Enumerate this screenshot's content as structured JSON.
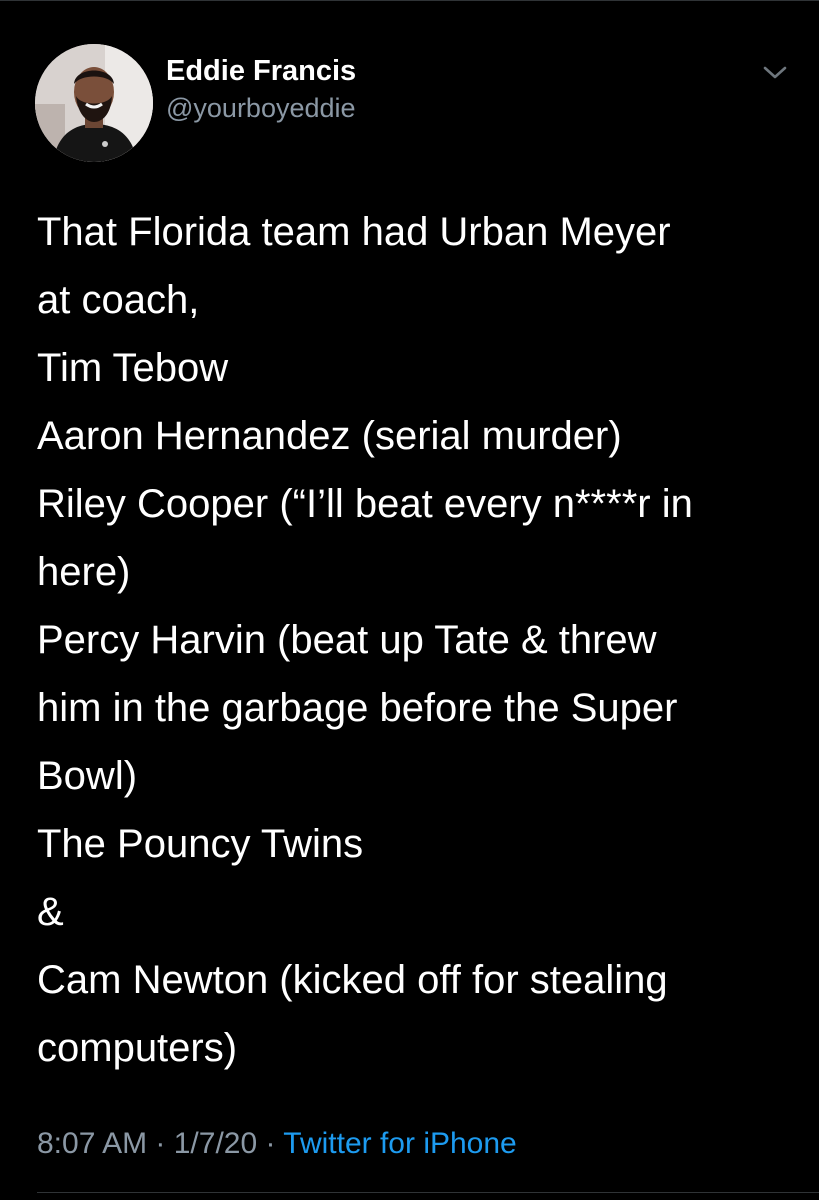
{
  "user": {
    "display_name": "Eddie Francis",
    "handle": "@yourboyeddie"
  },
  "tweet": {
    "lines": [
      "That Florida team had Urban Meyer",
      "at coach,",
      "Tim Tebow",
      "Aaron Hernandez (serial murder)",
      "Riley Cooper (“I’ll beat every n****r in",
      "here)",
      "Percy Harvin (beat up Tate & threw",
      "him in the garbage before the Super",
      "Bowl)",
      "The Pouncy Twins",
      "&",
      "Cam Newton (kicked off for stealing",
      "computers)"
    ]
  },
  "meta": {
    "time": "8:07 AM",
    "separator1": " · ",
    "date": "1/7/20",
    "separator2": " · ",
    "source": "Twitter for iPhone"
  },
  "icons": {
    "menu": "chevron-down-icon",
    "avatar": "avatar"
  },
  "colors": {
    "background": "#000000",
    "text": "#ffffff",
    "secondary": "#8b98a5",
    "accent": "#1d9bf0"
  }
}
